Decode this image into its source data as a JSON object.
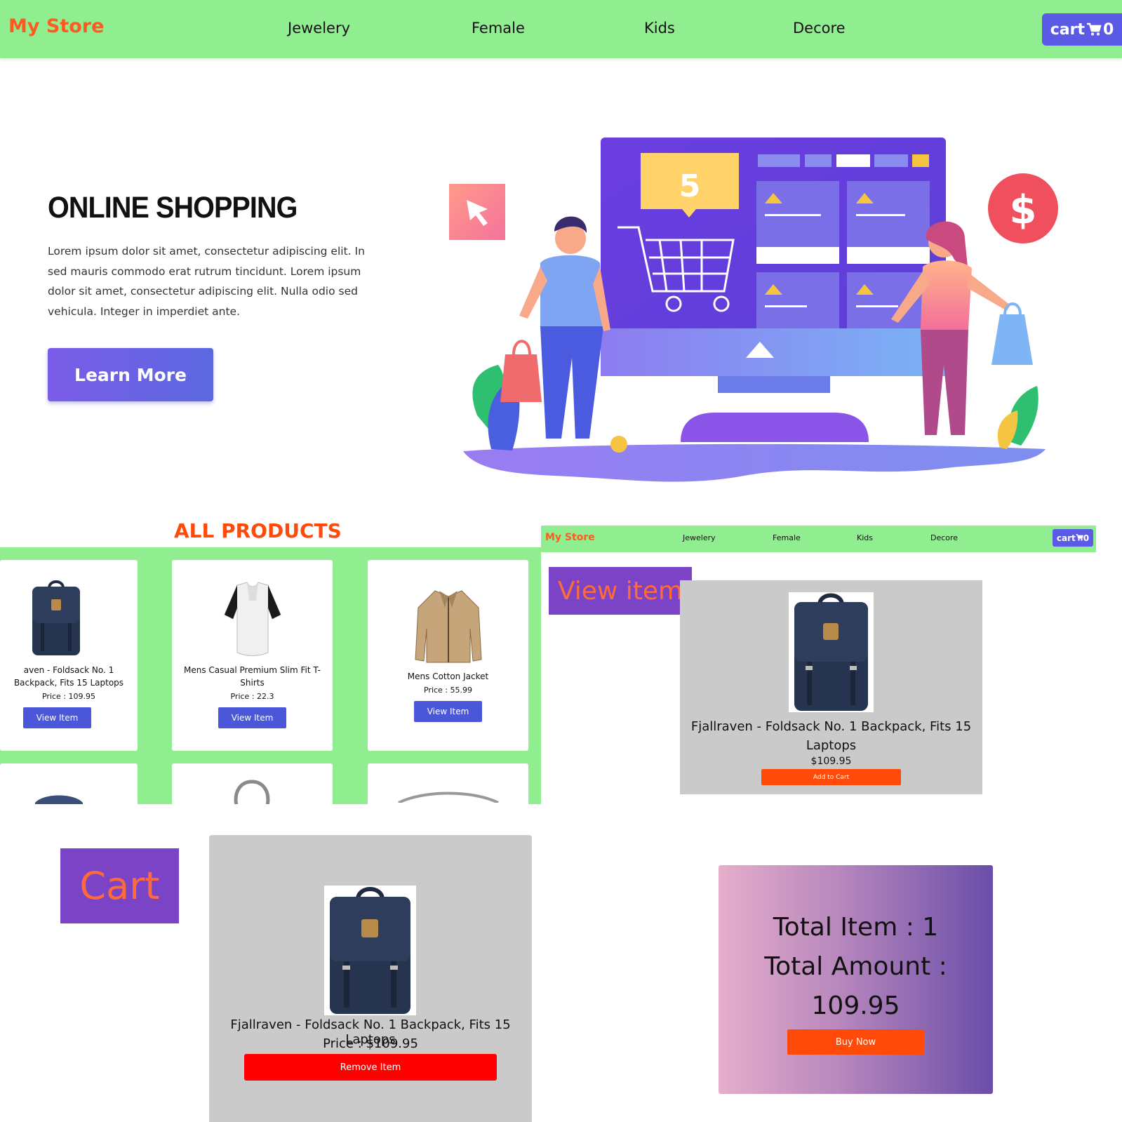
{
  "navbar": {
    "brand": "My Store",
    "links": [
      "Jewelery",
      "Female",
      "Kids",
      "Decore"
    ],
    "cart_label": "cart",
    "cart_count": "0"
  },
  "hero": {
    "title": "ONLINE SHOPPING",
    "text": "Lorem ipsum dolor sit amet, consectetur adipiscing elit. In sed mauris commodo erat rutrum tincidunt. Lorem ipsum dolor sit amet, consectetur adipiscing elit. Nulla  odio sed vehicula. Integer in imperdiet ante.",
    "button": "Learn More",
    "illustration_badge": "5",
    "illustration_coin": "$"
  },
  "products": {
    "title": "ALL PRODUCTS",
    "items": [
      {
        "name": "aven - Foldsack No. 1 Backpack, Fits 15 Laptops",
        "price": "Price : 109.95",
        "button": "View Item",
        "icon": "backpack-icon"
      },
      {
        "name": "Mens Casual Premium Slim Fit T-Shirts",
        "price": "Price : 22.3",
        "button": "View Item",
        "icon": "tshirt-icon"
      },
      {
        "name": "Mens Cotton Jacket",
        "price": "Price : 55.99",
        "button": "View Item",
        "icon": "jacket-icon"
      }
    ]
  },
  "mini_navbar": {
    "brand": "My Store",
    "links": [
      "Jewelery",
      "Female",
      "Kids",
      "Decore"
    ],
    "cart_label": "cart",
    "cart_count": "0"
  },
  "view_item": {
    "label": "View item",
    "name": "Fjallraven - Foldsack No. 1 Backpack, Fits 15 Laptops",
    "price": "$109.95",
    "button": "Add to Cart"
  },
  "cart": {
    "label": "Cart",
    "name": "Fjallraven - Foldsack No. 1 Backpack, Fits 15 Laptops",
    "price": "Price : $109.95",
    "button": "Remove Item"
  },
  "summary": {
    "total_items": "Total Item : 1",
    "total_amount_label": "Total Amount :",
    "total_amount": "109.95",
    "button": "Buy Now"
  },
  "colors": {
    "navbar_bg": "#90ee90",
    "brand": "#ff5a1f",
    "cart_button": "#5a5ae6",
    "accent_orange": "#ff4a0a",
    "remove_red": "#ff0000",
    "label_purple": "#7b44c6"
  }
}
